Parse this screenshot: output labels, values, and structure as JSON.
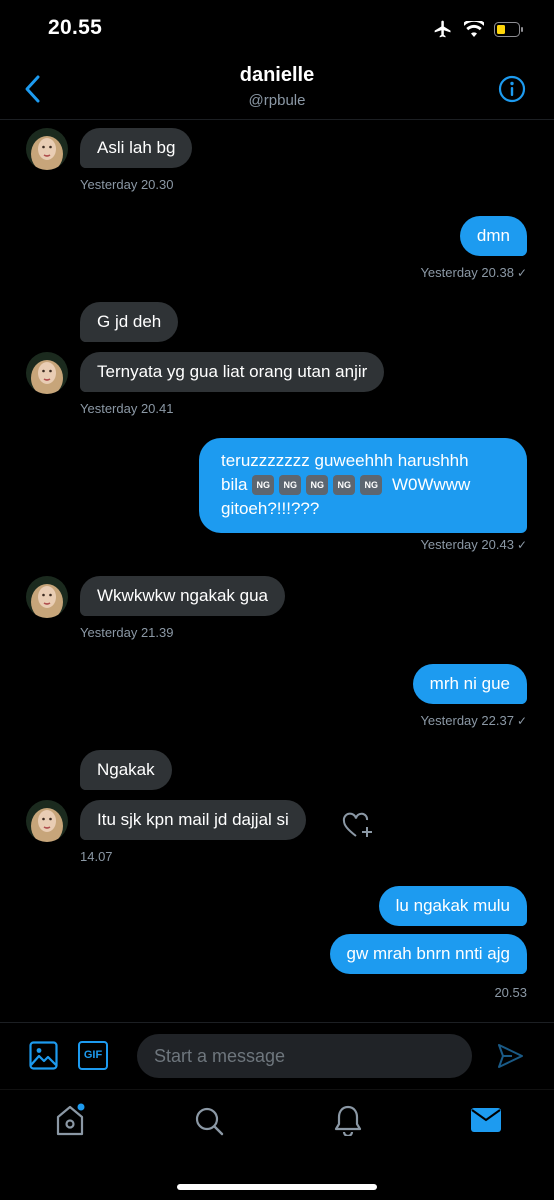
{
  "status": {
    "time": "20.55"
  },
  "header": {
    "name": "danielle",
    "handle": "@rpbule"
  },
  "messages": {
    "m1": "Asli lah bg",
    "t1": "Yesterday 20.30",
    "m2": "dmn",
    "t2": "Yesterday 20.38",
    "m3": "G jd deh",
    "m4": "Ternyata yg gua liat orang utan anjir",
    "t4": "Yesterday 20.41",
    "m5_line1": "teruzzzzzzz guweehhh harushhh",
    "m5_bila": "bila",
    "m5_ng": "NG",
    "m5_line2_end": "W0Wwww",
    "m5_line3": "gitoeh?!!!???",
    "t5": "Yesterday 20.43",
    "m6": "Wkwkwkw ngakak gua",
    "t6": "Yesterday 21.39",
    "m7": "mrh ni gue",
    "t7": "Yesterday 22.37",
    "m8": "Ngakak",
    "m9": "Itu sjk kpn mail jd dajjal si",
    "t9": "14.07",
    "m10": "lu ngakak mulu",
    "m11": "gw mrah bnrn nnti ajg",
    "t11": "20.53"
  },
  "composer": {
    "placeholder": "Start a message",
    "gif_label": "GIF"
  },
  "colors": {
    "accent": "#1d9bf0",
    "incoming_bubble": "#2f3336",
    "battery": "#ffd60a"
  },
  "icons": [
    "airplane-icon",
    "wifi-icon",
    "battery-icon",
    "back-icon",
    "info-icon",
    "image-icon",
    "gif-icon",
    "send-icon",
    "home-icon",
    "search-icon",
    "bell-icon",
    "mail-icon",
    "heart-plus-icon"
  ]
}
